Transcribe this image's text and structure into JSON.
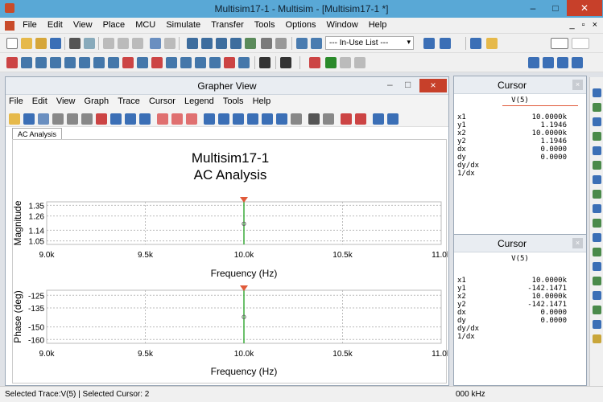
{
  "window": {
    "title": "Multisim17-1 - Multisim - [Multisim17-1 *]",
    "minimize": "–",
    "maximize": "□",
    "close": "✕"
  },
  "menubar": {
    "items": [
      "File",
      "Edit",
      "View",
      "Place",
      "MCU",
      "Simulate",
      "Transfer",
      "Tools",
      "Options",
      "Window",
      "Help"
    ],
    "mdi_controls": "_ ▫ ×"
  },
  "toolbar": {
    "inuse_list": "--- In-Use List ---"
  },
  "grapher": {
    "title": "Grapher View",
    "menu": [
      "File",
      "Edit",
      "View",
      "Graph",
      "Trace",
      "Cursor",
      "Legend",
      "Tools",
      "Help"
    ],
    "tab": "AC Analysis",
    "heading1": "Multisim17-1",
    "heading2": "AC Analysis"
  },
  "chart_data": [
    {
      "type": "line",
      "title": "Multisim17-1\nAC Analysis",
      "xlabel": "Frequency (Hz)",
      "ylabel": "Magnitude",
      "x_ticks": [
        "9.0k",
        "9.5k",
        "10.0k",
        "10.5k",
        "11.0k"
      ],
      "xlim": [
        9000,
        11000
      ],
      "y_ticks": [
        "1.35",
        "1.26",
        "1.14",
        "1.05"
      ],
      "ylim": [
        1.02,
        1.38
      ],
      "grid": true,
      "cursor_x": 10000,
      "series": [
        {
          "values": [
            1.1946
          ],
          "x": [
            10000
          ]
        }
      ]
    },
    {
      "type": "line",
      "xlabel": "Frequency (Hz)",
      "ylabel": "Phase (deg)",
      "x_ticks": [
        "9.0k",
        "9.5k",
        "10.0k",
        "10.5k",
        "11.0k"
      ],
      "xlim": [
        9000,
        11000
      ],
      "y_ticks": [
        "-125",
        "-135",
        "-150",
        "-160"
      ],
      "ylim": [
        -163,
        -121
      ],
      "grid": true,
      "cursor_x": 10000,
      "series": [
        {
          "values": [
            -142.1471
          ],
          "x": [
            10000
          ]
        }
      ]
    }
  ],
  "cursor1": {
    "title": "Cursor",
    "close": "×",
    "trace": "V(5)",
    "rows": [
      {
        "k": "x1",
        "v": "10.0000k"
      },
      {
        "k": "y1",
        "v": "1.1946"
      },
      {
        "k": "x2",
        "v": "10.0000k"
      },
      {
        "k": "y2",
        "v": "1.1946"
      },
      {
        "k": "dx",
        "v": "0.0000"
      },
      {
        "k": "dy",
        "v": "0.0000"
      },
      {
        "k": "dy/dx",
        "v": ""
      },
      {
        "k": "1/dx",
        "v": ""
      }
    ]
  },
  "cursor2": {
    "title": "Cursor",
    "close": "×",
    "trace": "V(5)",
    "rows": [
      {
        "k": "x1",
        "v": "10.0000k"
      },
      {
        "k": "y1",
        "v": "-142.1471"
      },
      {
        "k": "x2",
        "v": "10.0000k"
      },
      {
        "k": "y2",
        "v": "-142.1471"
      },
      {
        "k": "dx",
        "v": "0.0000"
      },
      {
        "k": "dy",
        "v": "0.0000"
      },
      {
        "k": "dy/dx",
        "v": ""
      },
      {
        "k": "1/dx",
        "v": ""
      }
    ]
  },
  "status": {
    "left": "Selected Trace:V(5)  |  Selected Cursor: 2",
    "freq": "000 kHz"
  },
  "colors": {
    "titlebar": "#59a8d6",
    "cursor_line": "#3aaa3a",
    "cursor_marker": "#e05a3a",
    "close_button": "#c7402a"
  }
}
